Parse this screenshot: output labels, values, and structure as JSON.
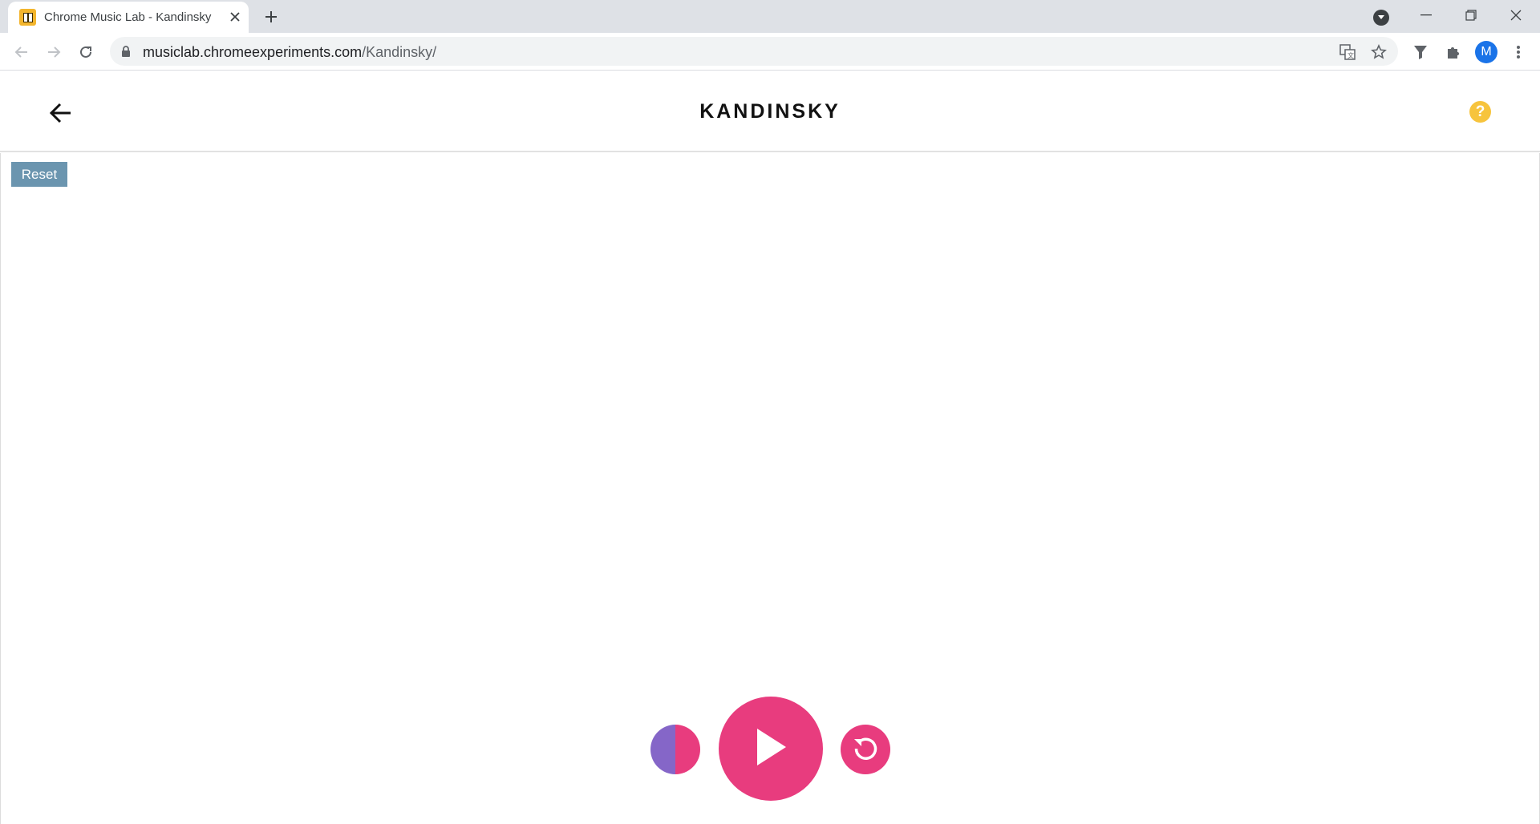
{
  "browser": {
    "tab": {
      "title": "Chrome Music Lab - Kandinsky",
      "favicon": "chrome-music-lab-favicon"
    },
    "url": {
      "host": "musiclab.chromeexperiments.com",
      "path": "/Kandinsky/"
    },
    "profile_initial": "M"
  },
  "page": {
    "title": "KANDINSKY",
    "help_label": "?",
    "reset_label": "Reset"
  },
  "colors": {
    "accent_pink": "#e83c7e",
    "accent_purple": "#8566c8",
    "reset_bg": "#6b95af",
    "help_yellow": "#f7c43d"
  },
  "icons": [
    "back-arrow-icon",
    "help-icon",
    "play-icon",
    "undo-icon",
    "color-mode-icon"
  ]
}
